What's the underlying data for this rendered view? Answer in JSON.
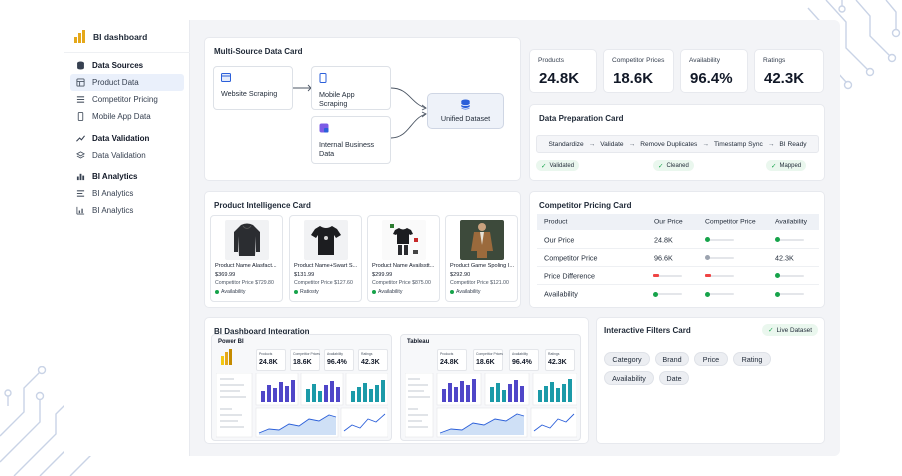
{
  "sidebar": {
    "brand": "BI dashboard",
    "sections": [
      {
        "label": "Data Sources",
        "icon": "database-icon",
        "items": [
          {
            "label": "Product Data",
            "icon": "product-data-icon",
            "active": true
          },
          {
            "label": "Competitor Pricing",
            "icon": "list-icon",
            "active": false
          },
          {
            "label": "Mobile App Data",
            "icon": "mobile-icon",
            "active": false
          }
        ]
      },
      {
        "label": "Data Validation",
        "icon": "trend-icon",
        "items": [
          {
            "label": "Data Validation",
            "icon": "layers-icon",
            "active": false
          }
        ]
      },
      {
        "label": "BI Analytics",
        "icon": "bar-chart-icon",
        "items": [
          {
            "label": "BI Analytics",
            "icon": "report-icon",
            "active": false
          },
          {
            "label": "BI Analytics",
            "icon": "analytics-icon",
            "active": false
          }
        ]
      }
    ]
  },
  "multisource": {
    "title": "Multi-Source Data Card",
    "website": "Website Scraping",
    "mobile": "Mobile App Scraping",
    "internal_line1": "Internal Business",
    "internal_line2": "Data",
    "unified": "Unified Dataset"
  },
  "kpis": [
    {
      "label": "Products",
      "value": "24.8K"
    },
    {
      "label": "Competitor Prices",
      "value": "18.6K"
    },
    {
      "label": "Availability",
      "value": "96.4%"
    },
    {
      "label": "Ratings",
      "value": "42.3K"
    }
  ],
  "prep": {
    "title": "Data Preparation Card",
    "steps": [
      "Standardize",
      "Validate",
      "Remove Duplicates",
      "Timestamp Sync",
      "BI Ready"
    ],
    "chips": [
      "Validated",
      "Cleaned",
      "Mapped"
    ]
  },
  "intel": {
    "title": "Product Intelligence Card",
    "products": [
      {
        "name": "Product Name Alasfact...",
        "price": "$369.99",
        "competitor": "Competitor Price $729.80",
        "status": "Availability"
      },
      {
        "name": "Product Name+Swart S...",
        "price": "$131.99",
        "competitor": "Competitor Price $127.60",
        "status": "Ratiosty"
      },
      {
        "name": "Product Name Availsstt...",
        "price": "$299.99",
        "competitor": "Competitor Price $875.00",
        "status": "Availability"
      },
      {
        "name": "Product Game Spoling I...",
        "price": "$292.90",
        "competitor": "Competitor Price $121.00",
        "status": "Availability"
      }
    ]
  },
  "pricing": {
    "title": "Competitor Pricing Card",
    "headers": [
      "Product",
      "Our Price",
      "Competitor Price",
      "Availability"
    ],
    "rows": [
      {
        "label": "Our Price",
        "our": "24.8K",
        "competitor": "",
        "availability": "",
        "our_bar": 0.1,
        "comp_bar": 0.1,
        "avail_bar": 0.1,
        "color": "#16a34a",
        "comp_color": "#16a34a",
        "avail_show": true
      },
      {
        "label": "Competitor Price",
        "our": "96.6K",
        "competitor": "",
        "availability": "42.3K",
        "our_bar": null,
        "comp_bar": 0.1,
        "avail_bar": null,
        "color": "#16a34a",
        "comp_color": "#9ca3af",
        "avail_show": false
      },
      {
        "label": "Price Difference",
        "our": "",
        "competitor": "",
        "availability": "",
        "our_bar": 0.1,
        "comp_bar": 0.1,
        "avail_bar": 0.1,
        "color": "#ef4444",
        "comp_color": "#ef4444",
        "avail_show": true
      },
      {
        "label": "Availability",
        "our": "",
        "competitor": "",
        "availability": "",
        "our_bar": 0.1,
        "comp_bar": 0.1,
        "avail_bar": 0.1,
        "color": "#16a34a",
        "comp_color": "#16a34a",
        "avail_show": true
      }
    ]
  },
  "bi": {
    "title": "BI Dashboard Integration",
    "panels": [
      {
        "name": "Power BI",
        "kpis": [
          {
            "label": "Products",
            "value": "24.8K"
          },
          {
            "label": "Competitor Prices",
            "value": "18.6K"
          },
          {
            "label": "Availability",
            "value": "96.4%"
          },
          {
            "label": "Ratings",
            "value": "42.3K"
          }
        ]
      },
      {
        "name": "Tableau",
        "kpis": [
          {
            "label": "Products",
            "value": "24.8K"
          },
          {
            "label": "Competitor Prices",
            "value": "18.6K"
          },
          {
            "label": "Availability",
            "value": "96.4%"
          },
          {
            "label": "Ratings",
            "value": "42.3K"
          }
        ]
      }
    ]
  },
  "filters": {
    "title": "Interactive Filters Card",
    "live": "Live Dataset",
    "chips": [
      "Category",
      "Brand",
      "Price",
      "Rating",
      "Availability",
      "Date"
    ]
  },
  "colors": {
    "accent": "#2b5fd9",
    "bar_purple": "#4f46c8",
    "bar_teal": "#1b9aa8",
    "green": "#16a34a",
    "red": "#ef4444"
  }
}
